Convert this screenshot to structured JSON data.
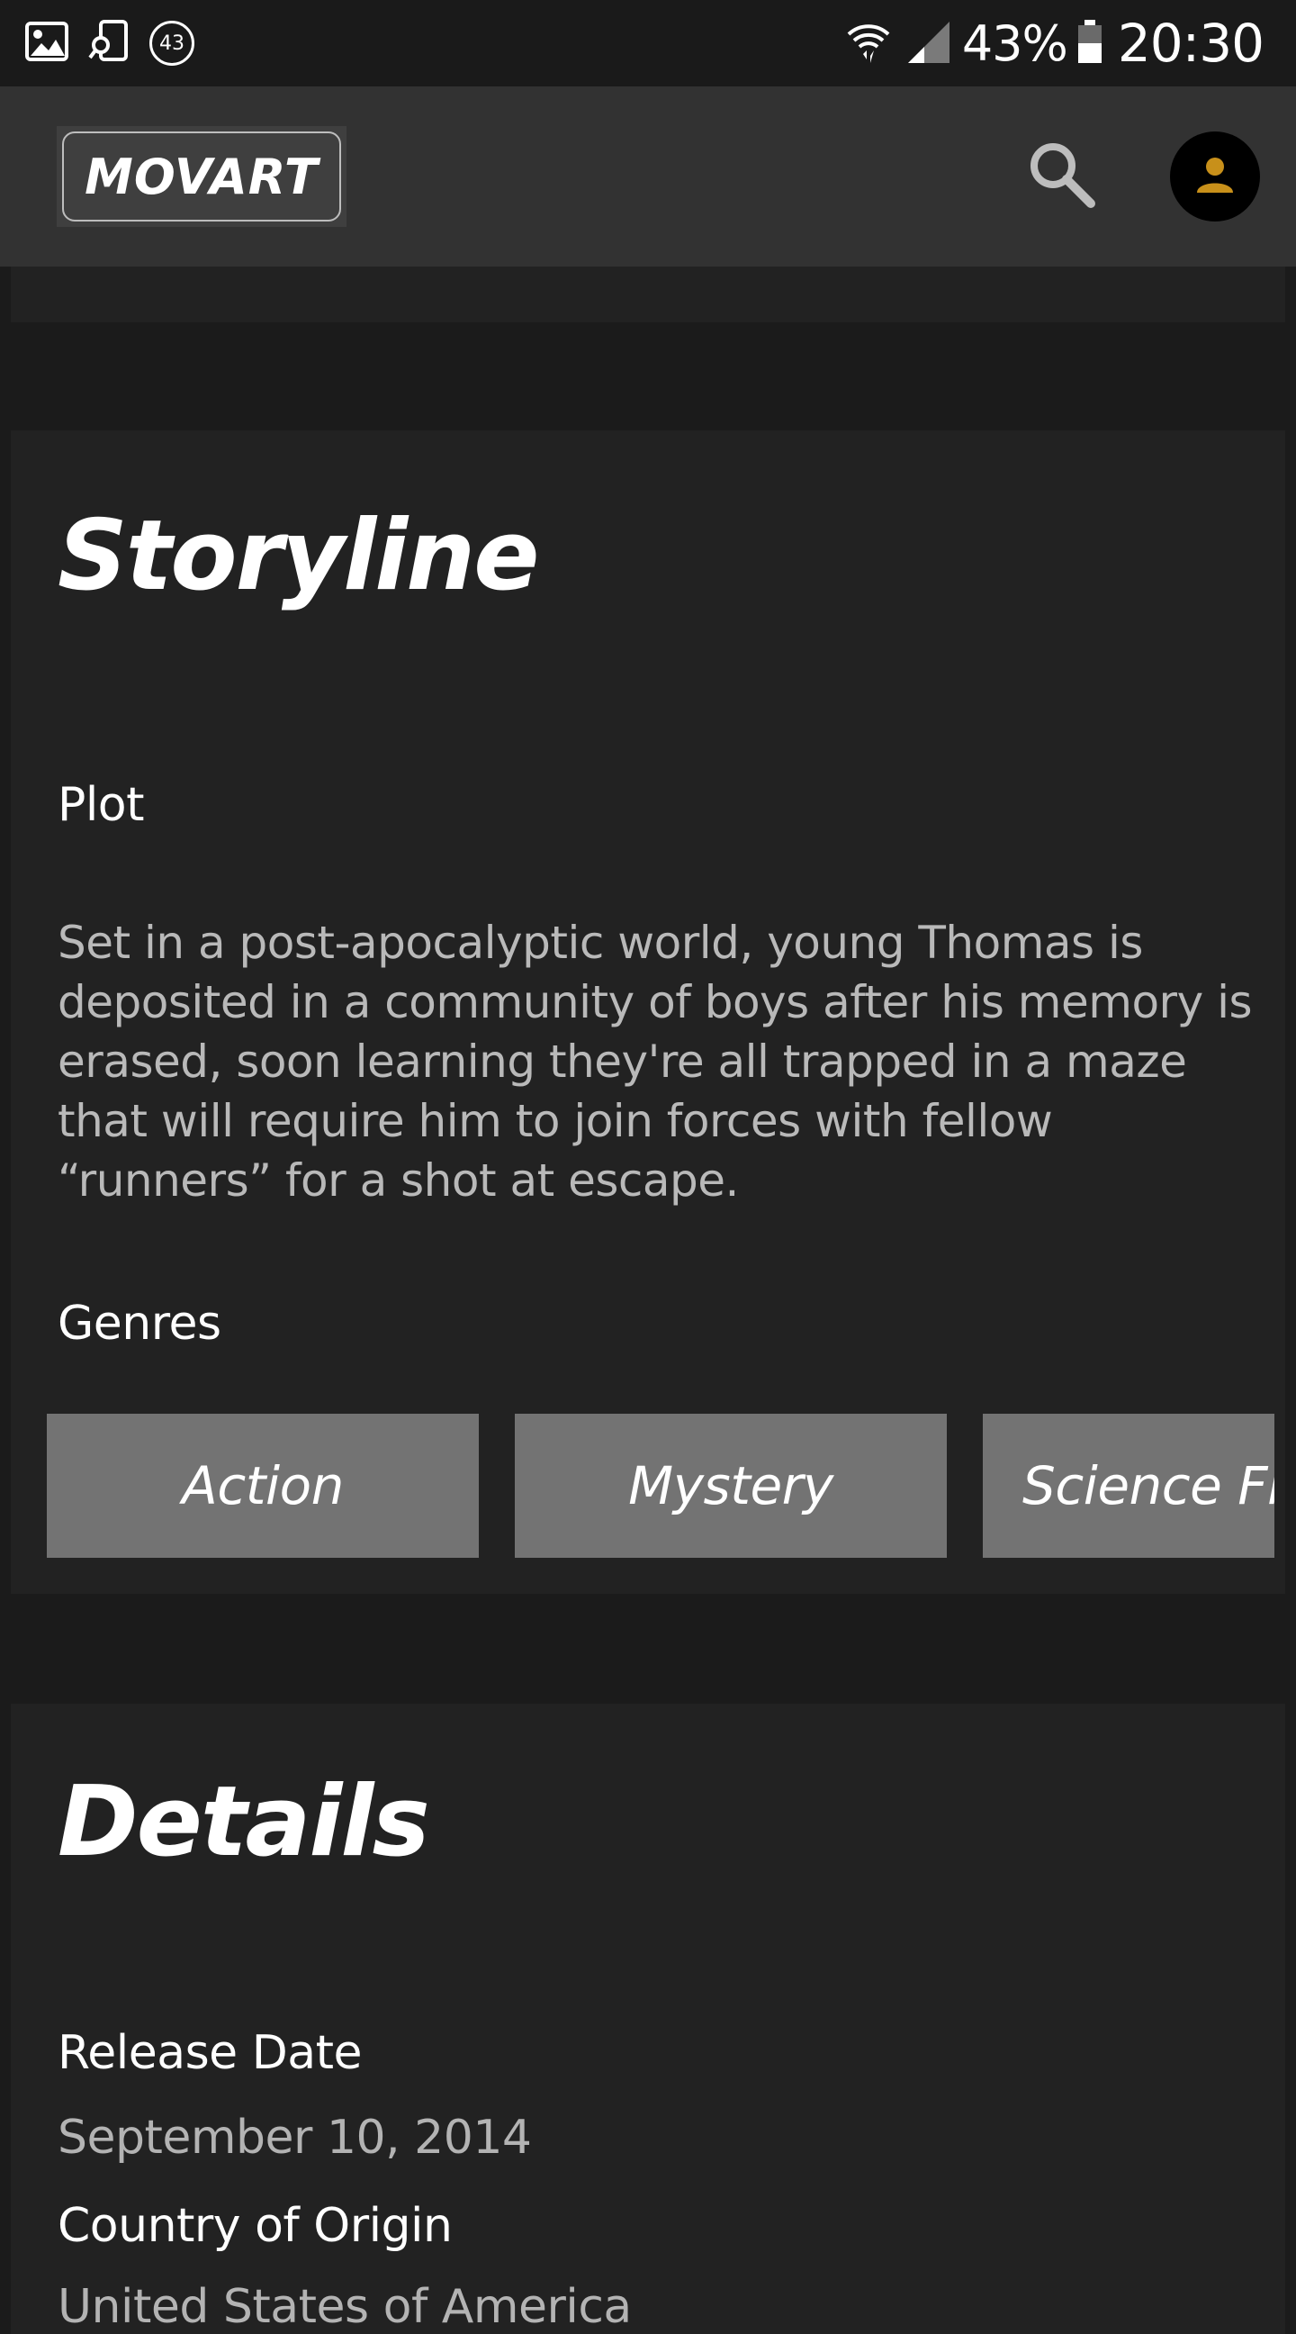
{
  "status_bar": {
    "notification_count": "43",
    "battery": "43%",
    "time": "20:30",
    "icons": [
      "image-icon",
      "screen-search-icon",
      "badge-icon",
      "wifi-icon",
      "signal-icon",
      "battery-icon"
    ]
  },
  "app_bar": {
    "logo": "MOVART",
    "search_icon": "search-icon",
    "avatar_icon": "person-icon",
    "avatar_color": "#c8901a"
  },
  "storyline": {
    "title": "Storyline",
    "plot_label": "Plot",
    "plot_text": "Set in a post-apocalyptic world, young Thomas is deposited in a community of boys after his memory is erased, soon learning they're all trapped in a maze that will require him to join forces with fellow “runners” for a shot at escape.",
    "genres_label": "Genres",
    "genres": [
      "Action",
      "Mystery",
      "Science Fiction"
    ]
  },
  "details": {
    "title": "Details",
    "release_date_label": "Release Date",
    "release_date": "September 10, 2014",
    "country_label": "Country of Origin",
    "country": "United States of America"
  }
}
